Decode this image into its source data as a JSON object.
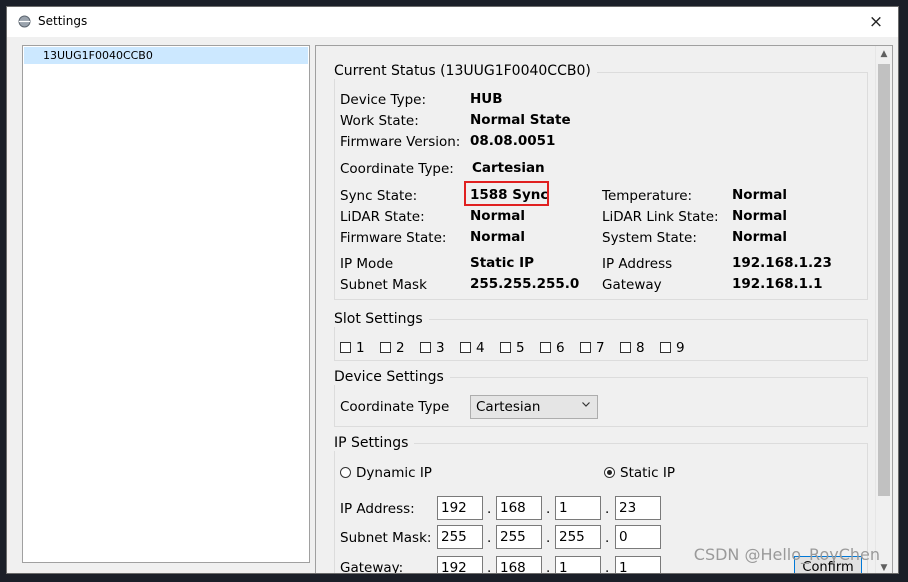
{
  "window": {
    "title": "Settings",
    "close_label": "×"
  },
  "tree": {
    "items": [
      {
        "label": "13UUG1F0040CCB0"
      }
    ]
  },
  "status": {
    "group_title": "Current Status (13UUG1F0040CCB0)",
    "device_type_label": "Device Type:",
    "device_type": "HUB",
    "work_state_label": "Work State:",
    "work_state": "Normal State",
    "firmware_version_label": "Firmware Version:",
    "firmware_version": "08.08.0051",
    "coordinate_type_label": "Coordinate Type:",
    "coordinate_type": "Cartesian",
    "sync_state_label": "Sync State:",
    "sync_state": "1588 Sync",
    "lidar_state_label": "LiDAR State:",
    "lidar_state": "Normal",
    "firmware_state_label": "Firmware State:",
    "firmware_state": "Normal",
    "temperature_label": "Temperature:",
    "temperature": "Normal",
    "lidar_link_state_label": "LiDAR Link State:",
    "lidar_link_state": "Normal",
    "system_state_label": "System State:",
    "system_state": "Normal",
    "ip_mode_label": "IP Mode",
    "ip_mode": "Static IP",
    "subnet_mask_label": "Subnet Mask",
    "subnet_mask": "255.255.255.0",
    "ip_address_label": "IP Address",
    "ip_address": "192.168.1.23",
    "gateway_label": "Gateway",
    "gateway": "192.168.1.1"
  },
  "slots": {
    "group_title": "Slot Settings",
    "items": [
      "1",
      "2",
      "3",
      "4",
      "5",
      "6",
      "7",
      "8",
      "9"
    ]
  },
  "device_settings": {
    "group_title": "Device Settings",
    "coordinate_type_label": "Coordinate Type",
    "coordinate_type_value": "Cartesian"
  },
  "ip_settings": {
    "group_title": "IP Settings",
    "dynamic_ip_label": "Dynamic IP",
    "static_ip_label": "Static IP",
    "selected": "Static IP",
    "ip_address_label": "IP Address:",
    "ip_address": [
      "192",
      "168",
      "1",
      "23"
    ],
    "subnet_mask_label": "Subnet Mask:",
    "subnet_mask": [
      "255",
      "255",
      "255",
      "0"
    ],
    "gateway_label": "Gateway:",
    "gateway": [
      "192",
      "168",
      "1",
      "1"
    ]
  },
  "confirm_label": "Confirm",
  "watermark": "CSDN @Hello_RoyChen"
}
